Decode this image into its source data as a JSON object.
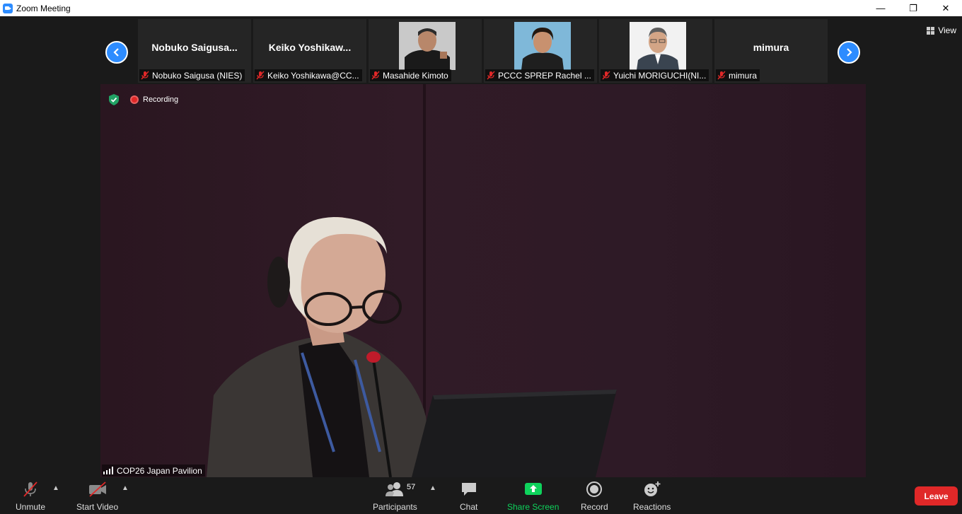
{
  "window": {
    "title": "Zoom Meeting",
    "minimize_glyph": "—",
    "restore_glyph": "❐",
    "close_glyph": "✕"
  },
  "view_button": {
    "label": "View",
    "icon": "grid-icon"
  },
  "thumbnails": [
    {
      "display_name": "Nobuko  Saigusa...",
      "label": "Nobuko Saigusa (NIES)",
      "muted": true,
      "has_video": false
    },
    {
      "display_name": "Keiko  Yoshikaw...",
      "label": "Keiko Yoshikawa@CC...",
      "muted": true,
      "has_video": false
    },
    {
      "display_name": "",
      "label": "Masahide Kimoto",
      "muted": true,
      "has_video": true
    },
    {
      "display_name": "",
      "label": "PCCC SPREP Rachel ...",
      "muted": true,
      "has_video": true
    },
    {
      "display_name": "",
      "label": "Yuichi MORIGUCHI(NI...",
      "muted": true,
      "has_video": true
    },
    {
      "display_name": "mimura",
      "label": "mimura",
      "muted": true,
      "has_video": false
    }
  ],
  "speaker": {
    "recording_label": "Recording",
    "name_label": "COP26 Japan Pavilion"
  },
  "toolbar": {
    "unmute_label": "Unmute",
    "start_video_label": "Start Video",
    "participants_label": "Participants",
    "participants_count": "57",
    "chat_label": "Chat",
    "share_screen_label": "Share Screen",
    "record_label": "Record",
    "reactions_label": "Reactions",
    "leave_label": "Leave"
  },
  "colors": {
    "accent": "#2d8cff",
    "share_green": "#0ed35c",
    "leave_red": "#e02828",
    "recording_red": "#e02828"
  }
}
